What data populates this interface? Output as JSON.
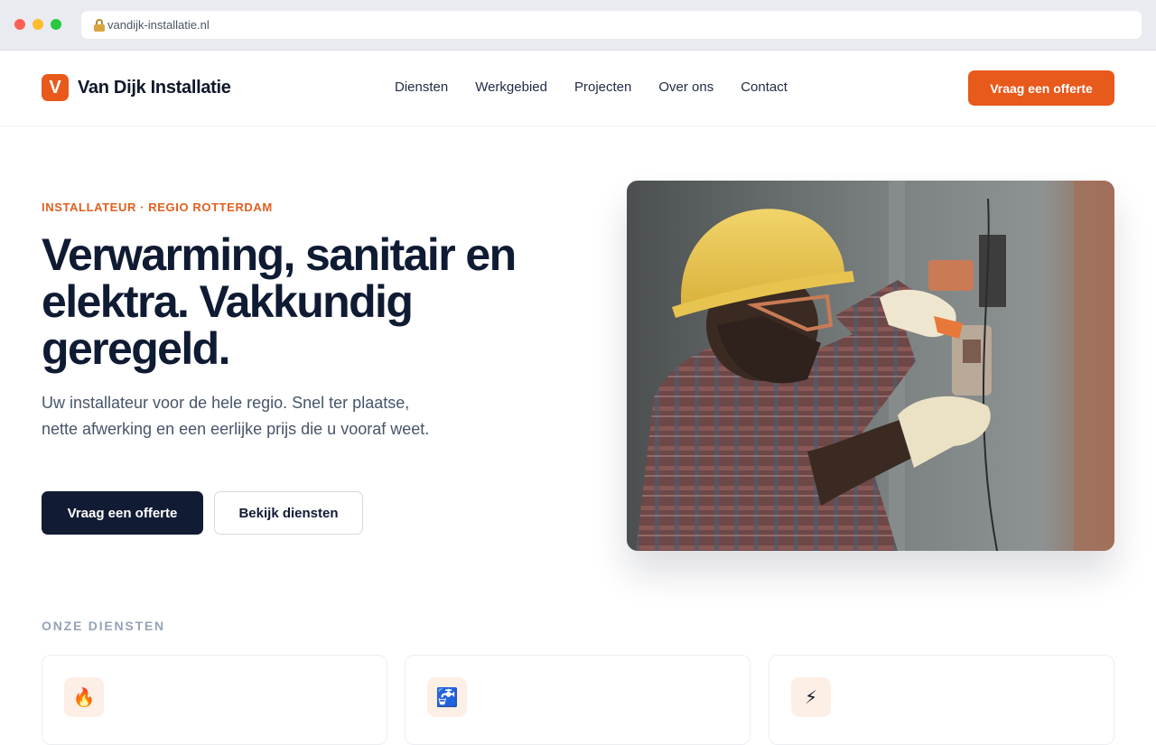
{
  "browser": {
    "url": "vandijk-installatie.nl"
  },
  "header": {
    "logo_letter": "V",
    "brand": "Van Dijk Installatie",
    "nav": [
      "Diensten",
      "Werkgebied",
      "Projecten",
      "Over ons",
      "Contact"
    ],
    "cta": "Vraag een offerte"
  },
  "hero": {
    "eyebrow": "INSTALLATEUR · REGIO ROTTERDAM",
    "headline": "Verwarming, sanitair en elektra. Vakkundig geregeld.",
    "lead": "Uw installateur voor de hele regio. Snel ter plaatse, nette afwerking en een eerlijke prijs die u vooraf weet.",
    "primary_button": "Vraag een offerte",
    "secondary_button": "Bekijk diensten"
  },
  "services": {
    "title": "ONZE DIENSTEN",
    "cards": [
      {
        "icon": "flame-icon",
        "glyph": "🔥"
      },
      {
        "icon": "faucet-icon",
        "glyph": "🚰"
      },
      {
        "icon": "lightning-icon",
        "glyph": "⚡"
      }
    ]
  },
  "colors": {
    "accent": "#e8591c",
    "dark": "#111b33"
  }
}
